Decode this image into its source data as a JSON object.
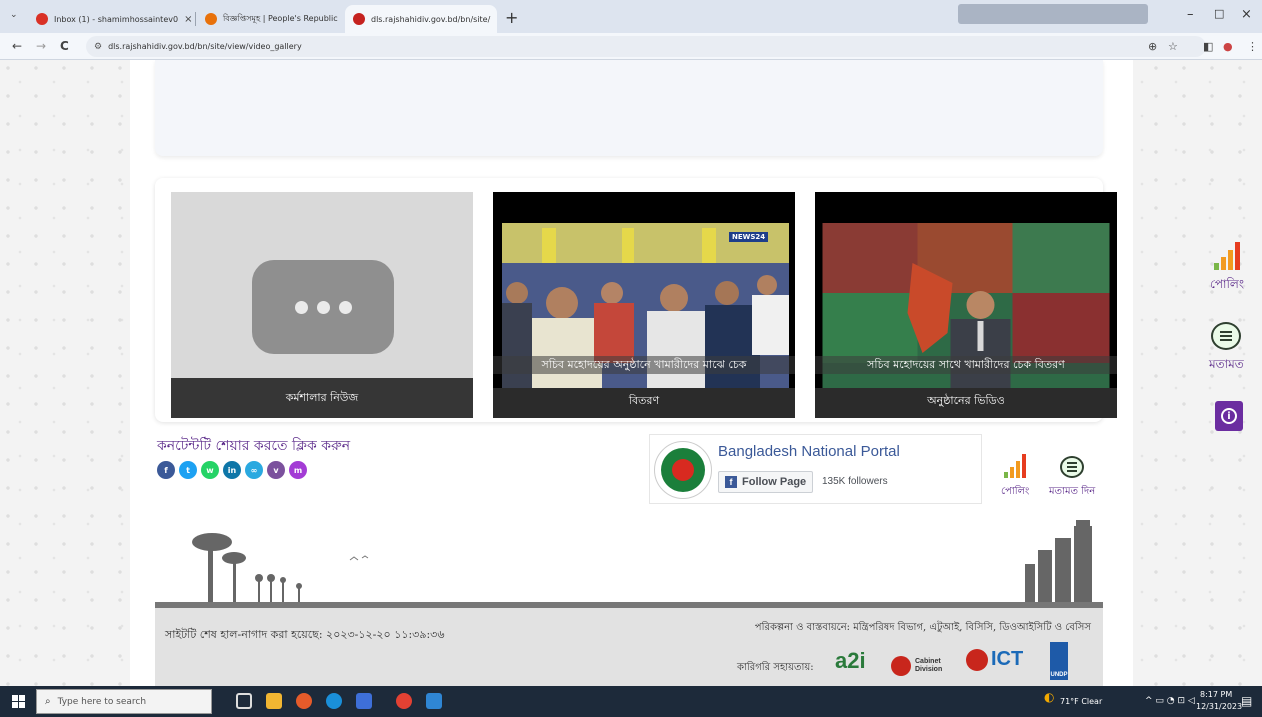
{
  "browser": {
    "tabs": [
      {
        "title": "Inbox (1) - shamimhossaintev0",
        "favicon_color": "#d93025",
        "active": false
      },
      {
        "title": "বিজ্ঞপ্তিসমূহ | People's Republic",
        "favicon_color": "#e8710a",
        "active": false
      },
      {
        "title": "dls.rajshahidiv.gov.bd/bn/site/",
        "favicon_color": "#c5221f",
        "active": true
      }
    ],
    "new_tab": "+",
    "url": "dls.rajshahidiv.gov.bd/bn/site/view/video_gallery",
    "nav": {
      "back": "←",
      "forward": "→",
      "reload": "C"
    },
    "window_controls": {
      "minimize": "–",
      "maximize": "□",
      "close": "×"
    }
  },
  "videos": [
    {
      "caption": "কর্মশালার নিউজ",
      "thumb": "placeholder"
    },
    {
      "caption_line1": "সচিব মহোদয়ের অনুষ্ঠানে খামারীদের মাঝে চেক",
      "caption_line2": "বিতরণ",
      "badge": "NEWS24",
      "thumb": "audience"
    },
    {
      "caption_line1": "সচিব মহোদয়ের সাথে খামারীদের চেক বিতরণ",
      "caption_line2": "অনুষ্ঠানের ভিডিও",
      "thumb": "news-anchor"
    }
  ],
  "share": {
    "title": "কনটেন্টটি শেয়ার করতে ক্লিক করুন",
    "icons": [
      {
        "name": "facebook",
        "glyph": "f",
        "color": "#3b5998"
      },
      {
        "name": "twitter",
        "glyph": "t",
        "color": "#1da1f2"
      },
      {
        "name": "whatsapp",
        "glyph": "w",
        "color": "#25d366"
      },
      {
        "name": "linkedin",
        "glyph": "in",
        "color": "#0e76a8"
      },
      {
        "name": "link",
        "glyph": "∞",
        "color": "#2aa9e0"
      },
      {
        "name": "viber",
        "glyph": "v",
        "color": "#7b519d"
      },
      {
        "name": "messenger",
        "glyph": "m",
        "color": "#a33cd5"
      }
    ]
  },
  "facebook_widget": {
    "page_name": "Bangladesh National Portal",
    "follow_label": "Follow Page",
    "followers": "135K followers"
  },
  "footer_actions": {
    "poll_label": "পোলিং",
    "feedback_label": "মতামত দিন"
  },
  "floating": {
    "poll_label": "পোলিং",
    "feedback_label": "মতামত"
  },
  "footer": {
    "last_updated": "সাইটটি শেষ হাল-নাগাদ করা হয়েছে: ২০২৩-১২-২০ ১১:৩৯:৩৬",
    "implementation": "পরিকল্পনা ও বাস্তবায়নে: মন্ত্রিপরিষদ বিভাগ, এটুআই, বিসিসি, ডিওআইসিটি ও বেসিস",
    "support_label": "কারিগরি সহায়তায়:",
    "logos": [
      "a2i",
      "Cabinet Division",
      "ICT",
      "UNDP"
    ]
  },
  "taskbar": {
    "search_placeholder": "Type here to search",
    "weather": "71°F Clear",
    "time": "8:17 PM",
    "date": "12/31/2023"
  },
  "colors": {
    "accent": "#5b2a8a",
    "footer_bg": "#e2e2e2",
    "caption_bg": "#2b2b2b"
  }
}
